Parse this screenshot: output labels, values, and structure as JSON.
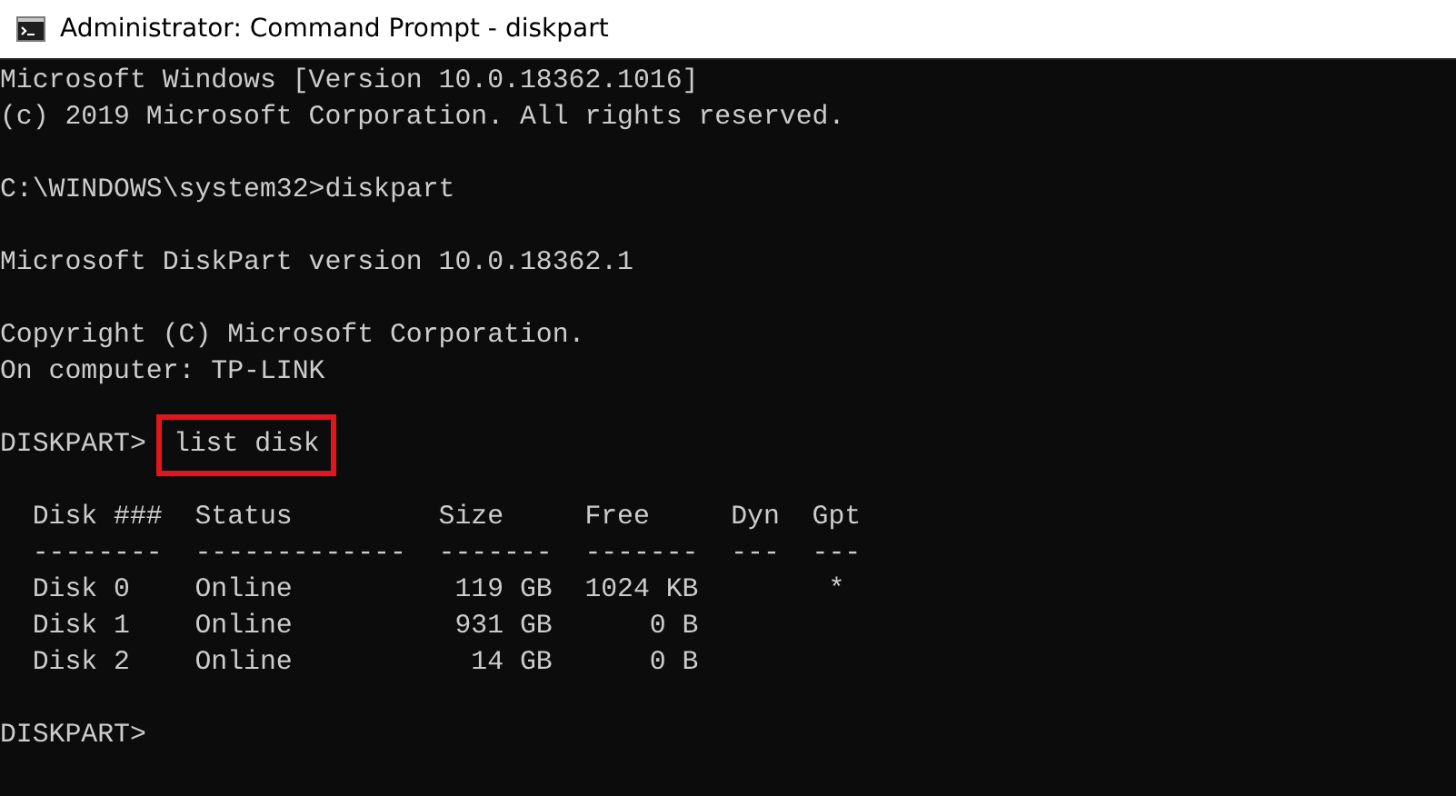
{
  "window": {
    "title": "Administrator: Command Prompt - diskpart"
  },
  "console": {
    "blocks": [
      {
        "lines": [
          {
            "kind": "text",
            "text": "Microsoft Windows [Version 10.0.18362.1016]"
          },
          {
            "kind": "text",
            "text": "(c) 2019 Microsoft Corporation. All rights reserved."
          }
        ]
      },
      {
        "lines": [
          {
            "kind": "command",
            "prompt": "C:\\WINDOWS\\system32>",
            "command": "diskpart",
            "highlighted": false
          }
        ]
      },
      {
        "lines": [
          {
            "kind": "text",
            "text": "Microsoft DiskPart version 10.0.18362.1"
          }
        ]
      },
      {
        "lines": [
          {
            "kind": "text",
            "text": "Copyright (C) Microsoft Corporation."
          },
          {
            "kind": "text",
            "text": "On computer: TP-LINK"
          }
        ]
      },
      {
        "lines": [
          {
            "kind": "command",
            "prompt": "DISKPART>",
            "command": "list disk",
            "highlighted": true
          }
        ]
      },
      {
        "lines": [
          {
            "kind": "text",
            "text": "  Disk ###  Status         Size     Free     Dyn  Gpt"
          },
          {
            "kind": "text",
            "text": "  --------  -------------  -------  -------  ---  ---"
          },
          {
            "kind": "text",
            "text": "  Disk 0    Online          119 GB  1024 KB        *"
          },
          {
            "kind": "text",
            "text": "  Disk 1    Online          931 GB      0 B"
          },
          {
            "kind": "text",
            "text": "  Disk 2    Online           14 GB      0 B"
          }
        ]
      },
      {
        "lines": [
          {
            "kind": "prompt",
            "prompt": "DISKPART>"
          }
        ]
      }
    ]
  }
}
